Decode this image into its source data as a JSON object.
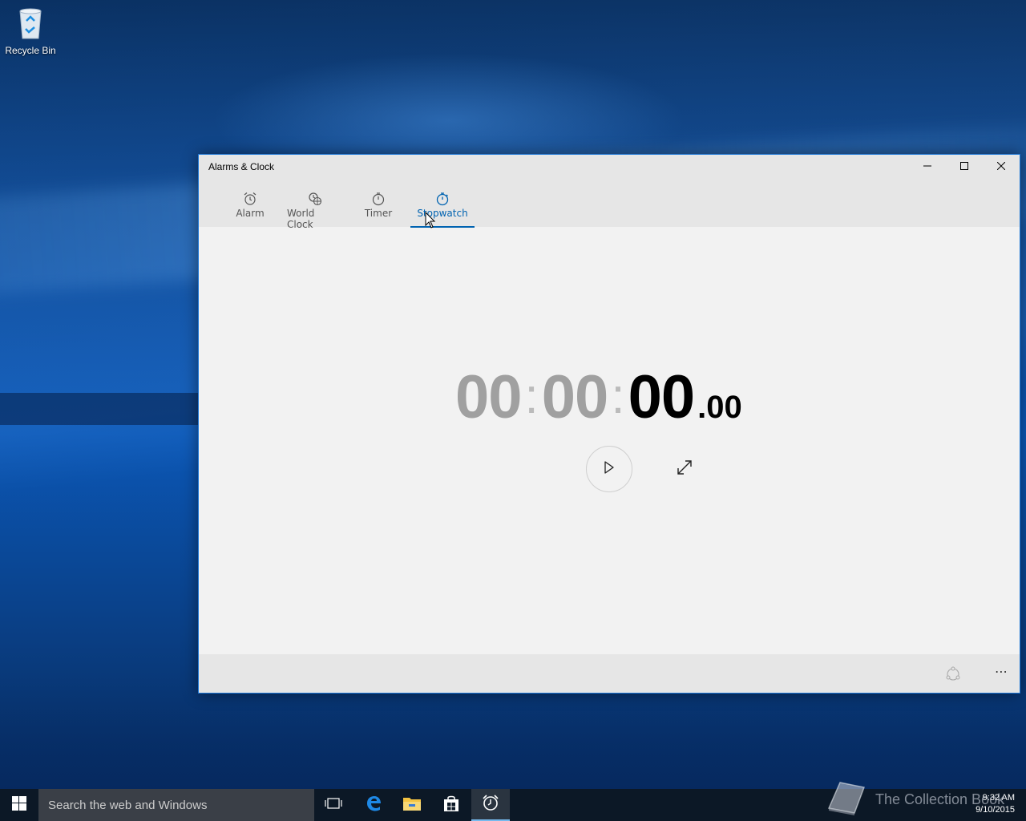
{
  "desktop": {
    "icons": [
      {
        "label": "Recycle Bin",
        "icon": "recycle-bin-icon"
      }
    ]
  },
  "window": {
    "title": "Alarms & Clock",
    "controls": {
      "minimize": "minimize-icon",
      "maximize": "maximize-icon",
      "close": "close-icon"
    },
    "tabs": [
      {
        "label": "Alarm",
        "icon": "alarm-clock-icon",
        "active": false
      },
      {
        "label": "World Clock",
        "icon": "world-clock-icon",
        "active": false
      },
      {
        "label": "Timer",
        "icon": "timer-icon",
        "active": false
      },
      {
        "label": "Stopwatch",
        "icon": "stopwatch-icon",
        "active": true
      }
    ],
    "stopwatch": {
      "hours": "00",
      "minutes": "00",
      "seconds": "00",
      "fraction": ".00",
      "colon": ":"
    },
    "appbar": {
      "more_label": "⋯",
      "pin_icon": "pin-icon"
    }
  },
  "taskbar": {
    "search_placeholder": "Search the web and Windows",
    "apps": [
      "task-view-icon",
      "edge-icon",
      "file-explorer-icon",
      "store-icon",
      "alarms-clock-icon"
    ],
    "clock_time": "9:32 AM",
    "clock_date": "9/10/2015",
    "watermark": "The Collection Book"
  },
  "colors": {
    "accent": "#0063b1",
    "window_bg": "#f2f2f2",
    "chrome_bg": "#e6e6e6",
    "taskbar_bg": "#0c1826"
  }
}
